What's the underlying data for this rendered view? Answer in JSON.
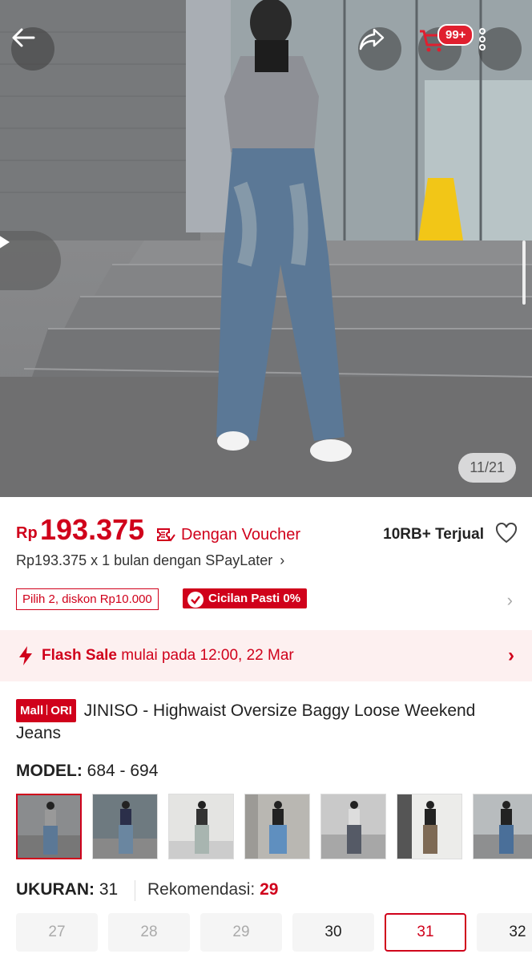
{
  "gallery": {
    "counter": "11/21",
    "cart_badge": "99+"
  },
  "price": {
    "currency": "Rp",
    "amount": "193.375",
    "voucher_label": "Dengan Voucher",
    "sold": "10RB+ Terjual",
    "spaylater": "Rp193.375 x 1 bulan dengan SPayLater"
  },
  "promo": {
    "discount_chip": "Pilih 2, diskon Rp10.000",
    "installment_chip": "Cicilan Pasti 0%"
  },
  "flash_sale": {
    "label": "Flash Sale",
    "text": "mulai pada 12:00, 22 Mar"
  },
  "product": {
    "tag_left": "Mall",
    "tag_right": "ORI",
    "title": "JINISO - Highwaist Oversize Baggy Loose Weekend Jeans"
  },
  "model": {
    "label": "MODEL:",
    "value": "684 - 694",
    "thumbnail_count": 7
  },
  "size": {
    "label": "UKURAN:",
    "value": "31",
    "recommendation_label": "Rekomendasi:",
    "recommendation_value": "29",
    "options": [
      {
        "label": "27",
        "state": "unavailable"
      },
      {
        "label": "28",
        "state": "unavailable"
      },
      {
        "label": "29",
        "state": "unavailable"
      },
      {
        "label": "30",
        "state": "available"
      },
      {
        "label": "31",
        "state": "selected"
      },
      {
        "label": "32",
        "state": "available"
      }
    ]
  },
  "colors": {
    "accent": "#d0011b",
    "flash_bg": "#fdf0f0"
  }
}
